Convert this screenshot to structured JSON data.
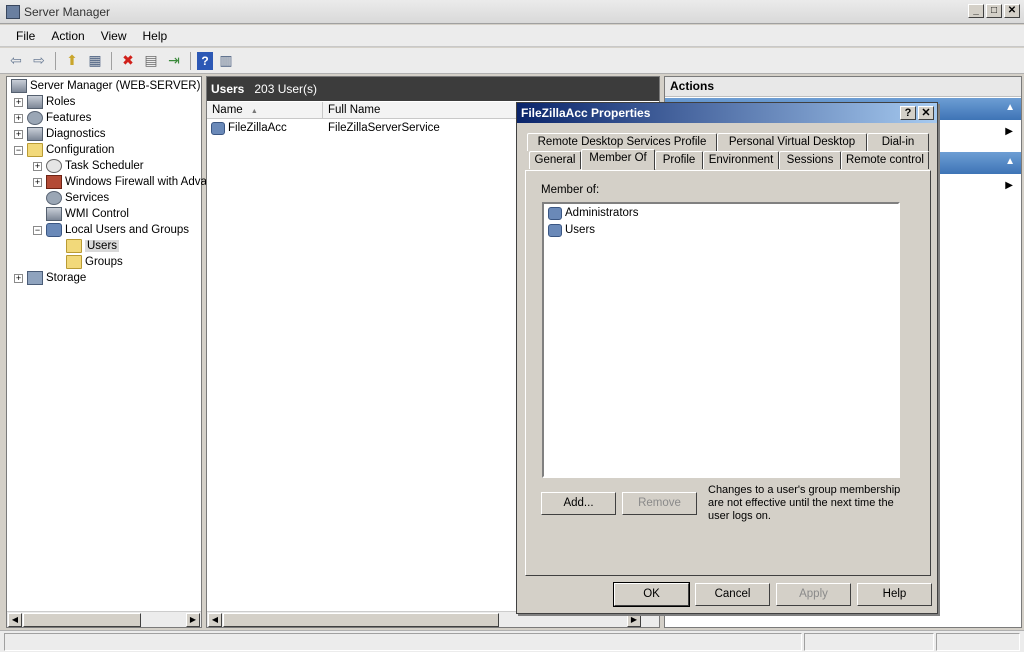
{
  "window": {
    "title": "Server Manager",
    "controls": [
      "_",
      "□",
      "✕"
    ]
  },
  "menu": [
    "File",
    "Action",
    "View",
    "Help"
  ],
  "toolbar": {
    "icons": [
      "back-arrow-icon",
      "forward-arrow-icon",
      "up-folder-icon",
      "show-hide-tree-icon",
      "delete-icon",
      "properties-icon",
      "export-icon",
      "help-icon",
      "action-pane-icon"
    ],
    "glyphs": [
      "⇦",
      "⇨",
      "⬆",
      "▦",
      "✖",
      "▤",
      "⇥",
      "?",
      "▥"
    ]
  },
  "tree": {
    "root": "Server Manager (WEB-SERVER)",
    "items": [
      {
        "label": "Roles",
        "expander": "+"
      },
      {
        "label": "Features",
        "expander": "+"
      },
      {
        "label": "Diagnostics",
        "expander": "+"
      },
      {
        "label": "Configuration",
        "expander": "−"
      },
      {
        "label": "Task Scheduler",
        "expander": "+"
      },
      {
        "label": "Windows Firewall with Adva",
        "expander": "+"
      },
      {
        "label": "Services",
        "expander": ""
      },
      {
        "label": "WMI Control",
        "expander": ""
      },
      {
        "label": "Local Users and Groups",
        "expander": "−"
      },
      {
        "label": "Users",
        "expander": ""
      },
      {
        "label": "Groups",
        "expander": ""
      },
      {
        "label": "Storage",
        "expander": "+"
      }
    ]
  },
  "list": {
    "title": "Users",
    "count": "203 User(s)",
    "columns": [
      "Name",
      "Full Name"
    ],
    "sort_indicator": "▲",
    "rows": [
      {
        "name": "FileZillaAcc",
        "full_name": "FileZillaServerService"
      }
    ]
  },
  "actions": {
    "title": "Actions",
    "band_chevron": "▲",
    "item_arrow": "▶"
  },
  "dialog": {
    "title": "FileZillaAcc Properties",
    "title_buttons": [
      "?",
      "✕"
    ],
    "tabs_row1": [
      "Remote Desktop Services Profile",
      "Personal Virtual Desktop",
      "Dial-in"
    ],
    "tabs_row2": [
      "General",
      "Member Of",
      "Profile",
      "Environment",
      "Sessions",
      "Remote control"
    ],
    "active_tab": "Member Of",
    "member_of_label": "Member of:",
    "groups": [
      "Administrators",
      "Users"
    ],
    "add_button": "Add...",
    "remove_button": "Remove",
    "note": "Changes to a user's group membership are not effective until the next time the user logs on.",
    "buttons": {
      "ok": "OK",
      "cancel": "Cancel",
      "apply": "Apply",
      "help": "Help"
    }
  },
  "scroll": {
    "left": "◀",
    "right": "▶"
  },
  "colors": {
    "dialog_title_start": "#0a246a",
    "dialog_title_end": "#a6caf0",
    "action_band": "#3e74b6",
    "list_header": "#3c3c3c"
  }
}
